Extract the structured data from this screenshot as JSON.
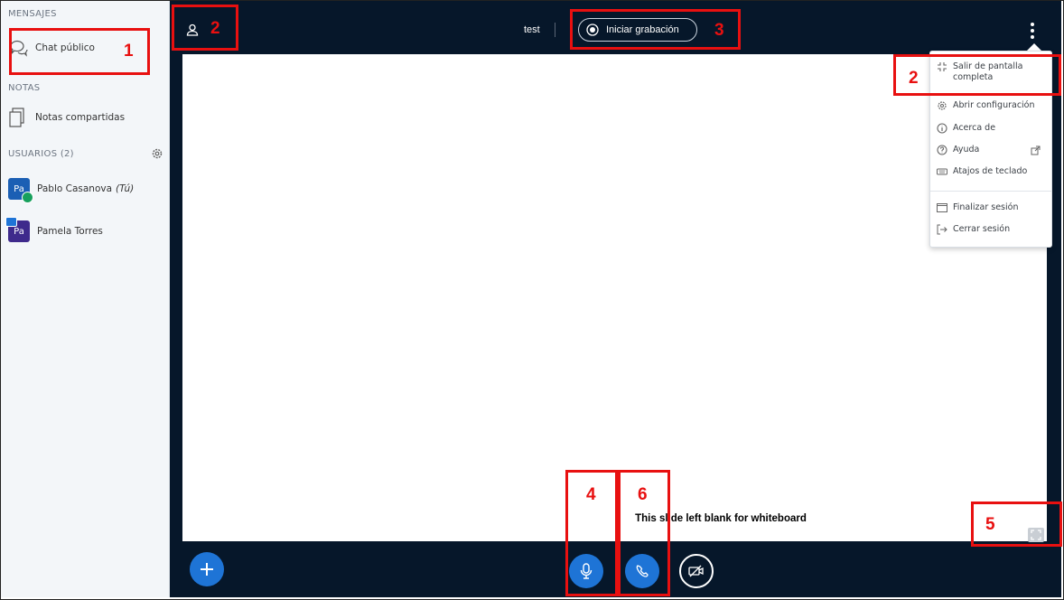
{
  "sidebar": {
    "messages_title": "MENSAJES",
    "public_chat_label": "Chat público",
    "notes_title": "NOTAS",
    "shared_notes_label": "Notas compartidas",
    "users_title": "USUARIOS (2)",
    "users": [
      {
        "initials": "Pa",
        "name": "Pablo Casanova",
        "suffix": "(Tú)",
        "color": "#1b5fb4"
      },
      {
        "initials": "Pa",
        "name": "Pamela Torres",
        "suffix": "",
        "color": "#3e2a8c"
      }
    ]
  },
  "topbar": {
    "meeting_title": "test",
    "record_label": "Iniciar grabación"
  },
  "menu": {
    "items": [
      {
        "label": "Salir de pantalla completa",
        "icon": "exit-fullscreen-icon"
      },
      {
        "label": "Abrir configuración",
        "icon": "gear-icon"
      },
      {
        "label": "Acerca de",
        "icon": "info-icon"
      },
      {
        "label": "Ayuda",
        "icon": "help-icon"
      },
      {
        "label": "Atajos de teclado",
        "icon": "keyboard-icon"
      },
      {
        "label": "Finalizar sesión",
        "icon": "window-icon"
      },
      {
        "label": "Cerrar sesión",
        "icon": "logout-icon"
      }
    ]
  },
  "whiteboard": {
    "text": "This slide left blank for whiteboard"
  },
  "annotations": [
    "1",
    "2",
    "3",
    "2",
    "4",
    "6",
    "5"
  ],
  "colors": {
    "dark_bg": "#06172a",
    "accent_blue": "#1e74d6",
    "annotation_red": "#e81010"
  }
}
